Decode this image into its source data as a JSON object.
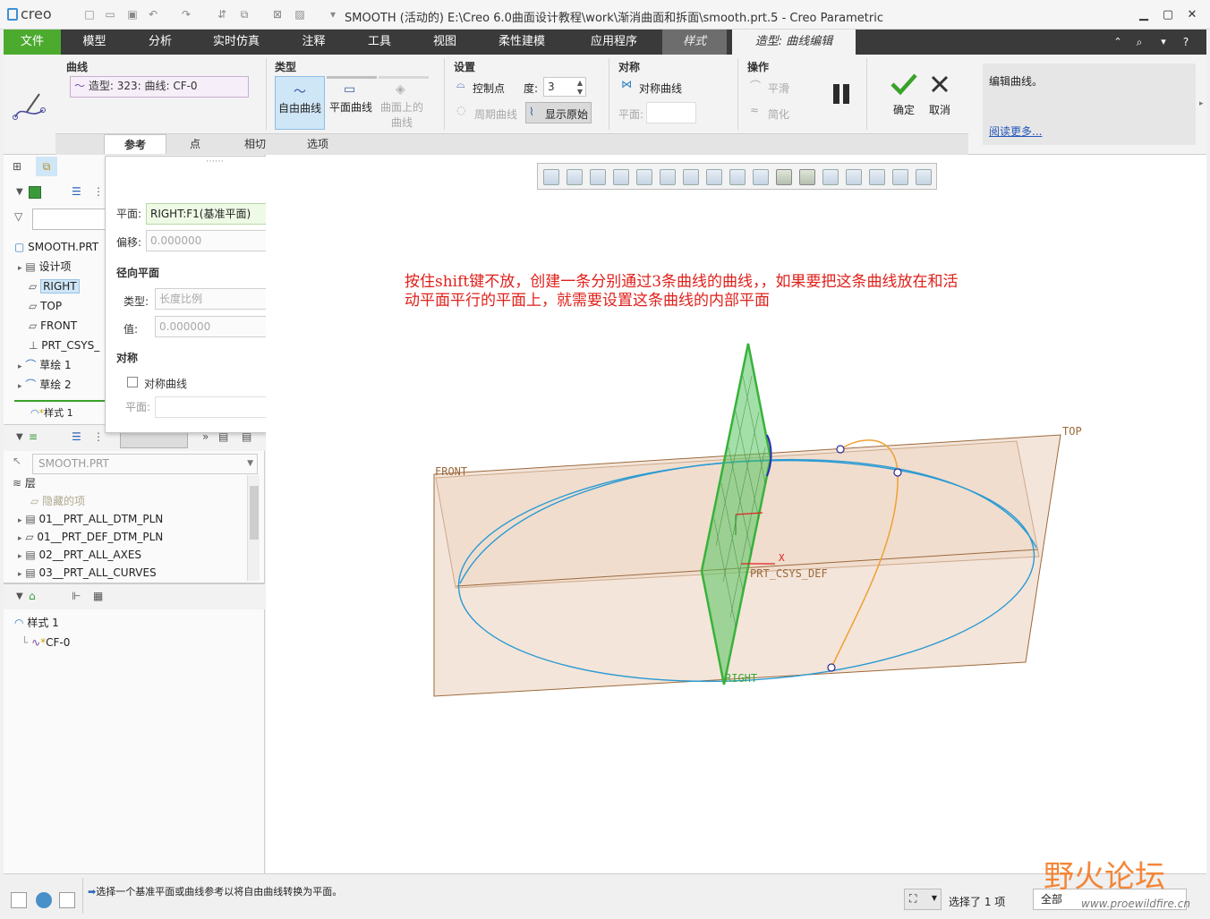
{
  "app": {
    "logo": "creo",
    "window_title": "SMOOTH (活动的) E:\\Creo 6.0曲面设计教程\\work\\渐消曲面和拆面\\smooth.prt.5 - Creo Parametric"
  },
  "menu": {
    "items": [
      "文件",
      "模型",
      "分析",
      "实时仿真",
      "注释",
      "工具",
      "视图",
      "柔性建模",
      "应用程序",
      "样式",
      "造型: 曲线编辑"
    ]
  },
  "ribbon": {
    "curve_group": {
      "title": "曲线",
      "value": "造型: 323: 曲线: CF-0"
    },
    "type_group": {
      "title": "类型",
      "free": "自由曲线",
      "planar": "平面曲线",
      "cos_line1": "曲面上的",
      "cos_line2": "曲线"
    },
    "settings_group": {
      "title": "设置",
      "control_points": "控制点",
      "degree_label": "度:",
      "degree_value": "3",
      "periodic": "周期曲线",
      "show_original": "显示原始"
    },
    "symmetry_group": {
      "title": "对称",
      "sym_curve": "对称曲线",
      "plane_label": "平面:"
    },
    "ops_group": {
      "title": "操作",
      "smooth": "平滑",
      "simplify": "简化"
    },
    "ok": "确定",
    "cancel": "取消",
    "help_text": "编辑曲线。",
    "read_more": "阅读更多..."
  },
  "subtabs": [
    "参考",
    "点",
    "相切",
    "选项"
  ],
  "popup": {
    "plane_label": "平面:",
    "plane_value": "RIGHT:F1(基准平面)",
    "offset_label": "偏移:",
    "offset_value": "0.000000",
    "radial_title": "径向平面",
    "type_label": "类型:",
    "type_value": "长度比例",
    "value_label": "值:",
    "value_value": "0.000000",
    "sym_title": "对称",
    "sym_checkbox": "对称曲线",
    "sym_plane_label": "平面:"
  },
  "model_tree": {
    "root": "SMOOTH.PRT",
    "items": [
      "设计项",
      "RIGHT",
      "TOP",
      "FRONT",
      "PRT_CSYS_",
      "草绘 1",
      "草绘 2",
      "样式 1"
    ]
  },
  "layer_tree": {
    "dropdown": "SMOOTH.PRT",
    "header": "层",
    "items": [
      "隐藏的项",
      "01__PRT_ALL_DTM_PLN",
      "01__PRT_DEF_DTM_PLN",
      "02__PRT_ALL_AXES",
      "03__PRT_ALL_CURVES"
    ]
  },
  "style_tree": {
    "root": "样式 1",
    "child": "CF-0"
  },
  "graphics": {
    "annotation_line1": "按住shift键不放，创建一条分别通过3条曲线的曲线，，如果要把这条曲线放在和活",
    "annotation_line2": "动平面平行的平面上，就需要设置这条曲线的内部平面",
    "label_front": "FRONT",
    "label_top": "TOP",
    "label_right": "RIGHT",
    "label_csys": "PRT_CSYS_DEF",
    "label_x": "X"
  },
  "status": {
    "message": "选择一个基准平面或曲线参考以将自由曲线转换为平面。",
    "selected": "选择了 1 项",
    "filter": "全部"
  },
  "watermark": {
    "text": "野火论坛",
    "url": "www.proewildfire.cn"
  }
}
